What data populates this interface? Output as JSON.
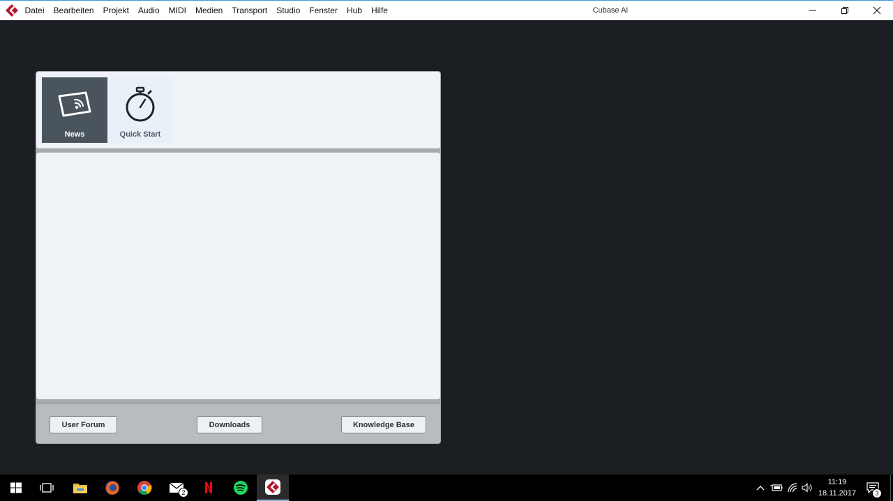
{
  "window": {
    "title": "Cubase AI"
  },
  "menu": {
    "items": [
      "Datei",
      "Bearbeiten",
      "Projekt",
      "Audio",
      "MIDI",
      "Medien",
      "Transport",
      "Studio",
      "Fenster",
      "Hub",
      "Hilfe"
    ]
  },
  "hub": {
    "tabs": [
      {
        "label": "News",
        "icon": "news-rss-icon",
        "selected": true
      },
      {
        "label": "Quick Start",
        "icon": "stopwatch-icon",
        "selected": false
      }
    ],
    "footer": {
      "user_forum": "User Forum",
      "downloads": "Downloads",
      "knowledge_base": "Knowledge Base"
    }
  },
  "taskbar": {
    "icons": [
      "windows-start-icon",
      "task-view-icon",
      "file-explorer-icon",
      "firefox-icon",
      "chrome-icon",
      "mail-icon",
      "netflix-icon",
      "spotify-icon",
      "cubase-icon"
    ],
    "mail_badge": "2",
    "clock": {
      "time": "11:19",
      "date": "18.11.2017"
    },
    "notification_badge": "3"
  },
  "colors": {
    "accent": "#3a9ad9",
    "cubase_red": "#b4162c",
    "desktop_bg": "#1b1e22"
  }
}
